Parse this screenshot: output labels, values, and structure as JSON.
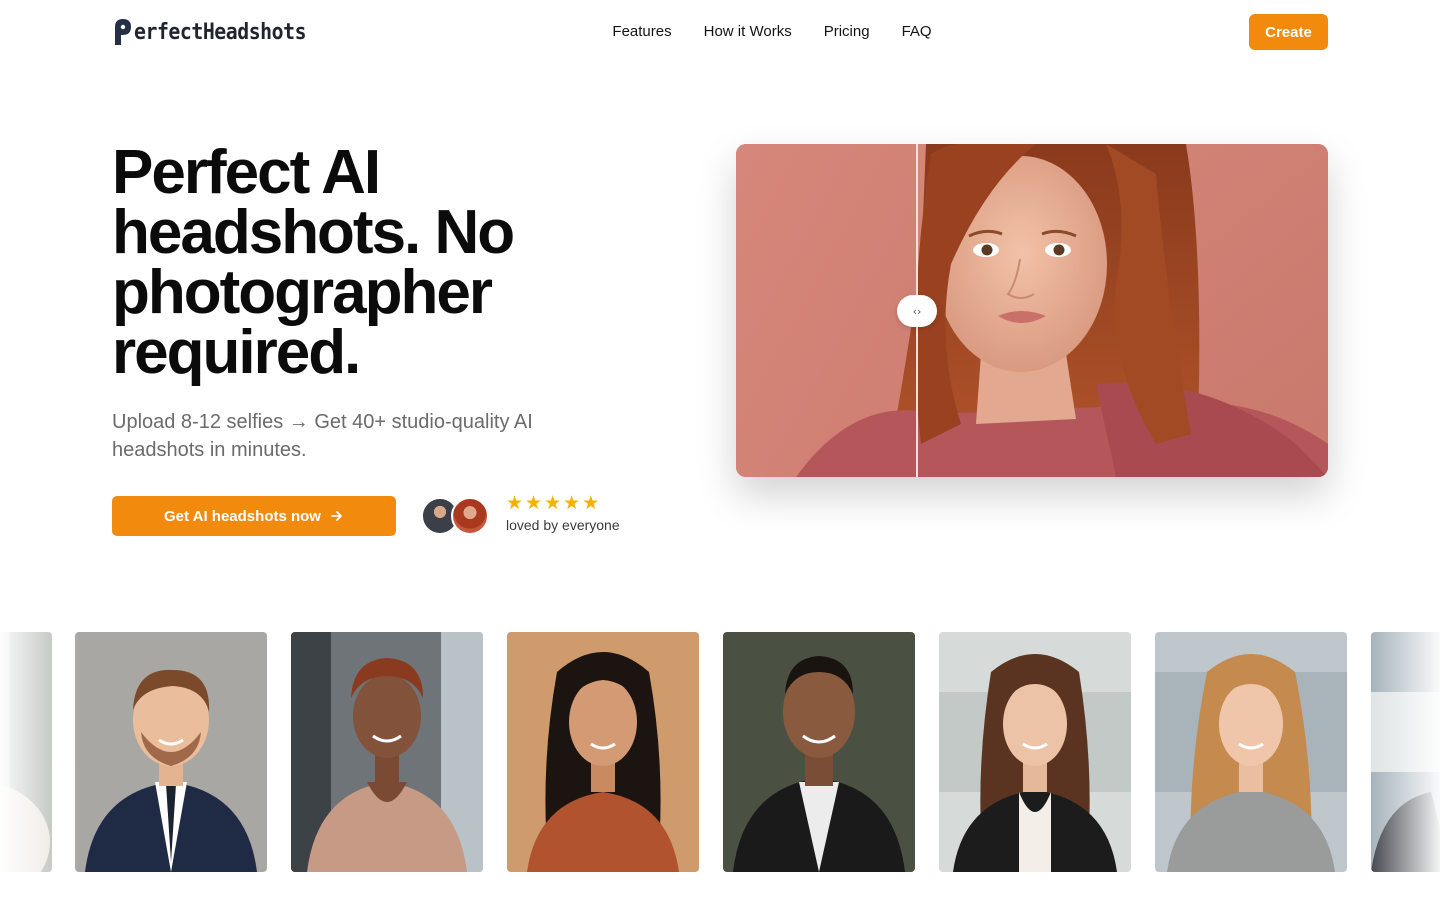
{
  "brand": {
    "name": "erfectHeadshots",
    "logo_icon": "p-head-logo-icon"
  },
  "nav": {
    "items": [
      {
        "label": "Features"
      },
      {
        "label": "How it Works"
      },
      {
        "label": "Pricing"
      },
      {
        "label": "FAQ"
      }
    ],
    "create_label": "Create"
  },
  "hero": {
    "title": "Perfect AI headshots. No photographer required.",
    "subtitle": "Upload 8-12 selfies → Get 40+ studio-quality AI headshots in minutes.",
    "cta_label": "Get AI headshots now",
    "cta_icon": "arrow-right-icon",
    "rating": 5,
    "rating_icon": "star-icon",
    "social_proof": "loved by everyone"
  },
  "compare": {
    "handle_glyph": "‹›",
    "handle_icon": "compare-slider-icon",
    "split": 0.31
  },
  "colors": {
    "accent": "#f28a0e",
    "star": "#f5b301",
    "text": "#0b0b0b",
    "muted": "#6b6b6b"
  },
  "gallery": {
    "count_visible": 8
  }
}
